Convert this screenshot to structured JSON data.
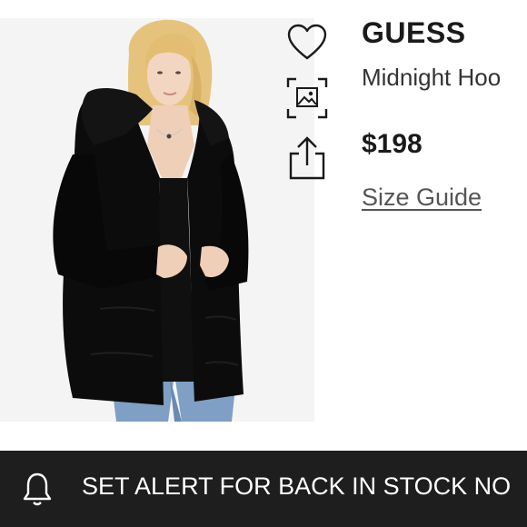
{
  "product": {
    "brand": "GUESS",
    "name": "Midnight Hoo",
    "price": "$198",
    "size_guide_label": "Size Guide"
  },
  "actions": {
    "favorite_icon": "heart-icon",
    "visual_search_icon": "visual-search-icon",
    "share_icon": "share-icon"
  },
  "alert_bar": {
    "icon": "bell-icon",
    "label": "SET ALERT FOR BACK IN STOCK NO"
  },
  "colors": {
    "alert_bar_background": "#1e1e1e",
    "alert_bar_text": "#ffffff",
    "coat": "#0c0c0c",
    "photo_background": "#f4f4f4"
  }
}
